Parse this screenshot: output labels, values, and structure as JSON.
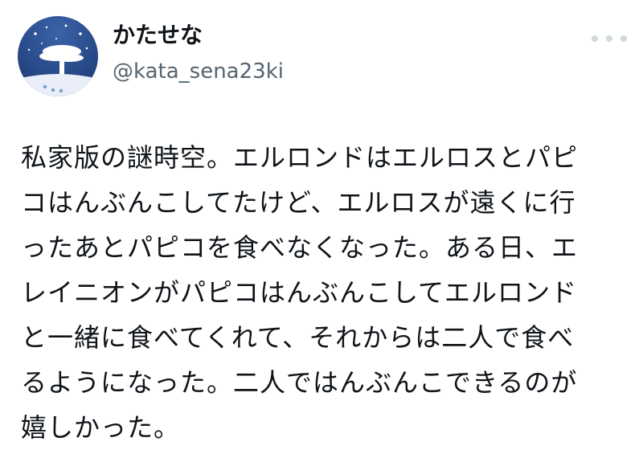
{
  "author": {
    "display_name": "かたせな",
    "handle": "@kata_sena23ki",
    "avatar_icon": "starry-night-tree-avatar"
  },
  "menu": {
    "icon": "more-options-icon"
  },
  "post": {
    "lines": [
      "私家版の謎時空。エルロンドはエルロスとパピ",
      "コはんぶんこしてたけど、エルロスが遠くに行",
      "ったあとパピコを食べなくなった。ある日、エ",
      "レイニオンがパピコはんぶんこしてエルロンド",
      "と一緒に食べてくれて、それからは二人で食べ",
      "るようになった。二人ではんぶんこできるのが",
      "嬉しかった。"
    ]
  },
  "colors": {
    "text": "#0f1419",
    "secondary_text": "#536471",
    "menu_dots": "#cfd9de",
    "avatar_sky": "#274a86"
  }
}
